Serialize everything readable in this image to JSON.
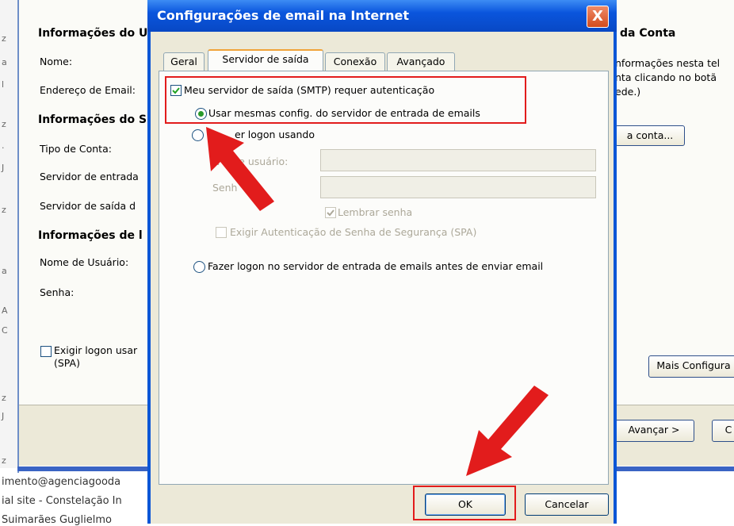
{
  "background_page": {
    "strip_chars": [
      "z",
      "a",
      "l",
      "z",
      "·",
      "J",
      "z",
      "a",
      "A",
      "C",
      "z",
      "J",
      "z"
    ],
    "bottom_lines": [
      "imento@agenciagooda",
      "ial site - Constelação In",
      "Suimarães Guglielmo"
    ]
  },
  "back_window": {
    "section_user": "Informações do U",
    "label_name": "Nome:",
    "label_email": "Endereço de Email:",
    "section_server": "Informações do S",
    "label_account_type": "Tipo de Conta:",
    "label_incoming": "Servidor de entrada",
    "label_outgoing": "Servidor de saída d",
    "section_logon": "Informações de l",
    "label_username": "Nome de Usuário:",
    "label_password": "Senha:",
    "check_spa": "Exigir logon usar",
    "check_spa_2": "(SPA)",
    "right_heading": "da Conta",
    "right_text_1": "nformações nesta tel",
    "right_text_2": "nta clicando no botã",
    "right_text_3": "ede.)",
    "test_button": "a conta...",
    "more_button": "Mais Configura",
    "next_button": "Avançar >",
    "cancel_button": "C"
  },
  "dialog": {
    "title": "Configurações de email na Internet",
    "close_label": "X",
    "tabs": [
      "Geral",
      "Servidor de saída",
      "Conexão",
      "Avançado"
    ],
    "smtp_auth_label": "Meu servidor de saída (SMTP) requer autenticação",
    "smtp_auth_checked": true,
    "radio_same": "Usar mesmas config. do servidor de entrada de emails",
    "radio_logon": "er logon usando",
    "user_label": "N    de usuário:",
    "password_label": "Senh",
    "remember_label": "Lembrar senha",
    "spa_label": "Exigir Autenticação de Senha de Segurança (SPA)",
    "radio_pop": "Fazer logon no servidor de entrada de emails antes de enviar email",
    "ok_button": "OK",
    "cancel_button": "Cancelar"
  },
  "colors": {
    "highlight": "#e21c1c",
    "titlebar": "#0a55dd",
    "dialog_bg": "#ece9d8"
  }
}
